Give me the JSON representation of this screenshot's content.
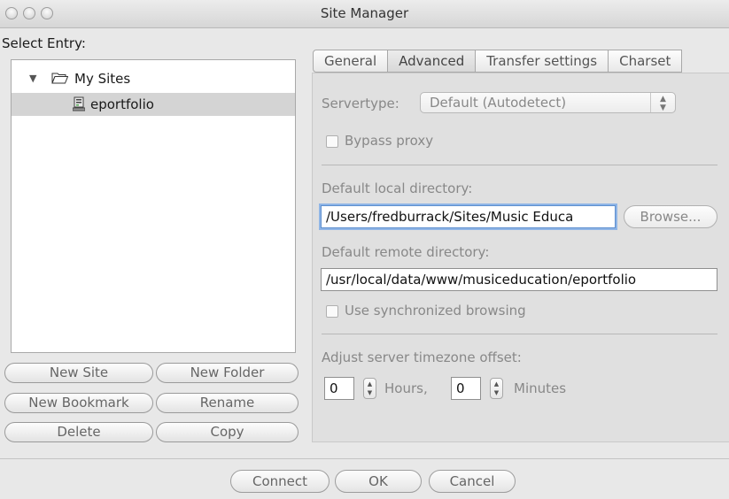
{
  "window": {
    "title": "Site Manager"
  },
  "left": {
    "select_entry_label": "Select Entry:",
    "tree": [
      {
        "label": "My Sites",
        "type": "folder",
        "expanded": true
      },
      {
        "label": "eportfolio",
        "type": "site",
        "selected": true
      }
    ],
    "buttons": {
      "new_site": "New Site",
      "new_folder": "New Folder",
      "new_bookmark": "New Bookmark",
      "rename": "Rename",
      "delete": "Delete",
      "copy": "Copy"
    }
  },
  "tabs": [
    {
      "label": "General",
      "active": false
    },
    {
      "label": "Advanced",
      "active": true
    },
    {
      "label": "Transfer settings",
      "active": false
    },
    {
      "label": "Charset",
      "active": false
    }
  ],
  "advanced": {
    "servertype_label": "Servertype:",
    "servertype_value": "Default (Autodetect)",
    "bypass_proxy_label": "Bypass proxy",
    "bypass_proxy_checked": false,
    "local_dir_label": "Default local directory:",
    "local_dir_value": "/Users/fredburrack/Sites/Music Educa",
    "browse_label": "Browse...",
    "remote_dir_label": "Default remote directory:",
    "remote_dir_value": "/usr/local/data/www/musiceducation/eportfolio",
    "sync_browsing_label": "Use synchronized browsing",
    "sync_browsing_checked": false,
    "timezone_label": "Adjust server timezone offset:",
    "hours_value": "0",
    "hours_label": "Hours,",
    "minutes_value": "0",
    "minutes_label": "Minutes"
  },
  "footer": {
    "connect": "Connect",
    "ok": "OK",
    "cancel": "Cancel"
  },
  "colors": {
    "selection": "#d4d4d4",
    "focus_ring": "#8fb5e6"
  }
}
